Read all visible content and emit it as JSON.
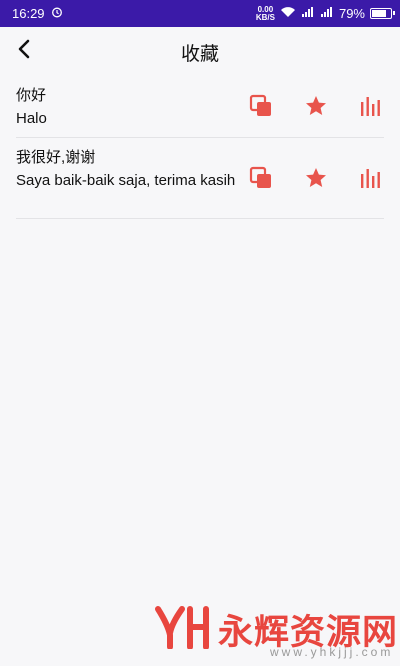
{
  "status_bar": {
    "time": "16:29",
    "net_speed_value": "0.00",
    "net_speed_unit": "KB/S",
    "battery_percent": "79%",
    "battery_level": 0.79,
    "icons": [
      "alarm-icon",
      "wifi-icon",
      "4g-signal-icon",
      "signal-icon",
      "battery-icon"
    ]
  },
  "header": {
    "title": "收藏",
    "back_icon": "chevron-left-icon"
  },
  "accent_color": "#e8544c",
  "favorites": [
    {
      "chinese": "你好",
      "translation": "Halo"
    },
    {
      "chinese": "我很好,谢谢",
      "translation": "Saya baik-baik saja, terima kasih"
    }
  ],
  "row_actions": [
    "copy-icon",
    "star-icon",
    "audio-bars-icon"
  ],
  "watermark": {
    "text": "永辉资源网",
    "url": "www.yhkjjj.com"
  }
}
